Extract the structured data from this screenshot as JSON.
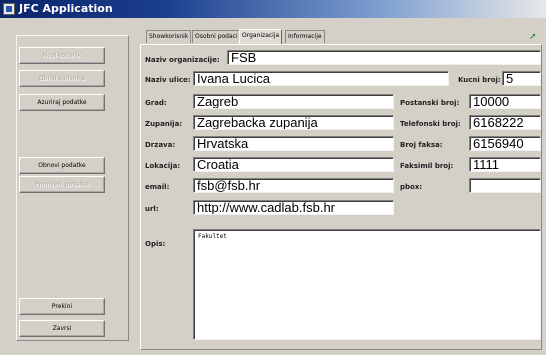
{
  "window": {
    "title": "JFC Application"
  },
  "buttons": {
    "novi_korisnik": "Novi korisnik",
    "obrisi_korisnika": "Obrisi korisnika",
    "azuriraj": "Azuriraj podatke",
    "obnovi": "Obnovi podatke",
    "promijeni": "Promijeni podatke",
    "prekini": "Prekini",
    "zavrsi": "Zavrsi"
  },
  "tabs": [
    "Showkorisnik",
    "Osobni podaci",
    "Organizacija",
    "Informacije"
  ],
  "form": {
    "naziv_organizacije": {
      "label": "Naziv organizacije:",
      "value": "FSB"
    },
    "naziv_ulice": {
      "label": "Naziv ulice:",
      "value": "Ivana Lucica"
    },
    "kucni_broj": {
      "label": "Kucni broj:",
      "value": "5"
    },
    "grad": {
      "label": "Grad:",
      "value": "Zagreb"
    },
    "postanski_broj": {
      "label": "Postanski broj:",
      "value": "10000"
    },
    "zupanija": {
      "label": "Zupanija:",
      "value": "Zagrebacka zupanija"
    },
    "telefonski_broj": {
      "label": "Telefonski broj:",
      "value": "6168222"
    },
    "drzava": {
      "label": "Drzava:",
      "value": "Hrvatska"
    },
    "broj_faksa": {
      "label": "Broj faksa:",
      "value": "6156940"
    },
    "lokacija": {
      "label": "Lokacija:",
      "value": "Croatia"
    },
    "faksimil_broj": {
      "label": "Faksimil broj:",
      "value": "1111"
    },
    "email": {
      "label": "email:",
      "value": "fsb@fsb.hr"
    },
    "pbox": {
      "label": "pbox:",
      "value": ""
    },
    "url": {
      "label": "url:",
      "value": "http://www.cadlab.fsb.hr"
    },
    "opis": {
      "label": "Opis:",
      "value": "Fakultet"
    }
  }
}
